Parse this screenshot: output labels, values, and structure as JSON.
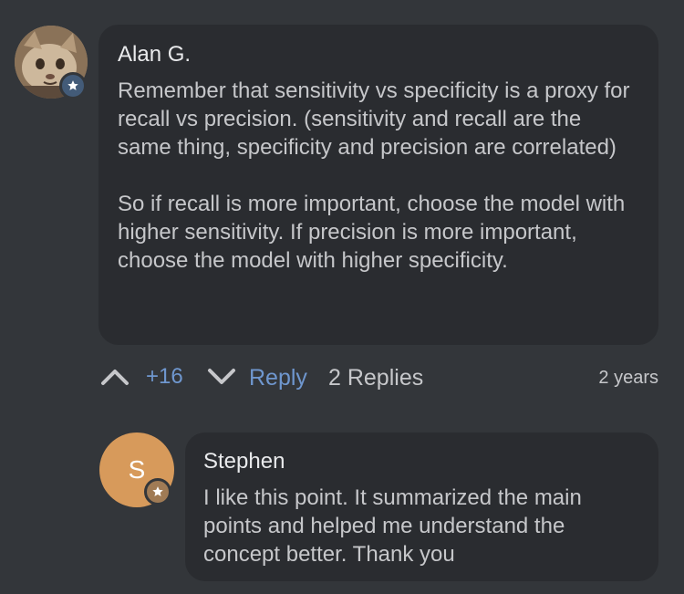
{
  "comment": {
    "author": "Alan G.",
    "paragraphs": [
      "Remember that sensitivity vs specificity is a proxy for recall vs precision. (sensitivity and recall are the same thing, specificity and precision are correlated)",
      "So if recall is more important, choose the model with higher sensitivity. If precision is more important, choose the model with higher specificity."
    ],
    "avatar_icon": "cat-photo-avatar",
    "badge_icon": "star-badge-icon"
  },
  "actions": {
    "upvote_icon": "chevron-up-icon",
    "score": "+16",
    "downvote_icon": "chevron-down-icon",
    "reply_label": "Reply",
    "replies_label": "2 Replies",
    "timestamp": "2 years"
  },
  "reply": {
    "author": "Stephen",
    "avatar_initial": "S",
    "text": "I like this point. It summarized the main points and helped me understand the concept better. Thank you",
    "badge_icon": "star-badge-icon"
  },
  "colors": {
    "background": "#33363a",
    "bubble": "#2a2c30",
    "accent": "#6f97cf",
    "avatar_initial_bg": "#d79a5b",
    "badge_blue": "#435b78"
  }
}
